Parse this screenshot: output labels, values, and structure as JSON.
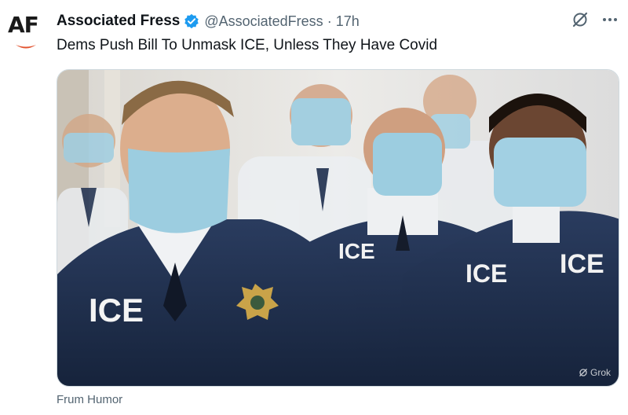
{
  "account": {
    "avatar_text": "AF",
    "display_name": "Associated Fress",
    "handle": "@AssociatedFress",
    "separator": "·",
    "time_ago": "17h",
    "verified_icon": "blue-check-icon",
    "verified_color": "#1d9bf0"
  },
  "post": {
    "text": "Dems Push Bill To Unmask ICE, Unless They Have Covid",
    "media": {
      "badge_text": "ICE",
      "watermark": "Grok"
    },
    "caption": "Frum Humor"
  },
  "actions": {
    "grok_icon": "grok-slash-icon",
    "more_icon": "more-dots-icon"
  },
  "colors": {
    "text_primary": "#0f1419",
    "text_secondary": "#536471",
    "uniform_navy": "#1e2f4f",
    "mask_blue": "#9ccde0",
    "brand_accent": "#e2532f"
  }
}
